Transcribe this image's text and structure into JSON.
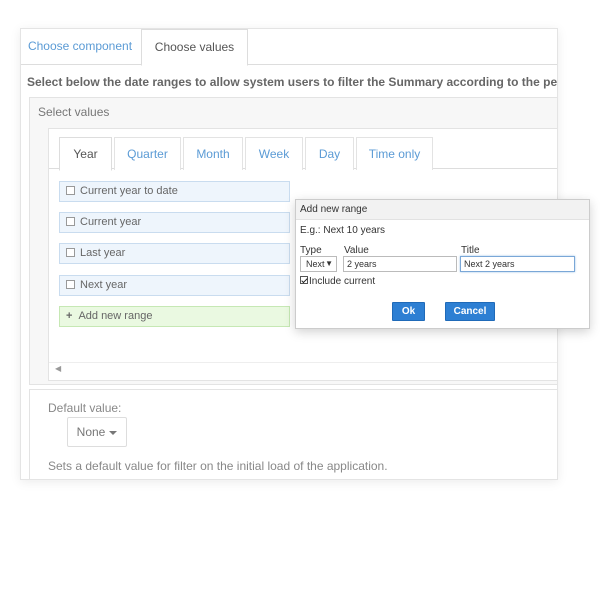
{
  "tabs": {
    "choose_component": "Choose component",
    "choose_values": "Choose values"
  },
  "instruction": "Select below the date ranges to allow system users to filter the Summary according to the periods di",
  "select_values": {
    "label": "Select values",
    "tabs": [
      "Year",
      "Quarter",
      "Month",
      "Week",
      "Day",
      "Time only"
    ],
    "active_tab": "Year",
    "ranges": [
      "Current year to date",
      "Current year",
      "Last year",
      "Next year"
    ],
    "add_range_label": "Add new range"
  },
  "default_value": {
    "label": "Default value:",
    "selected": "None",
    "help": "Sets a default value for filter on the initial load of the application."
  },
  "dialog": {
    "title": "Add new range",
    "example": "E.g.: Next 10 years",
    "type_label": "Type",
    "value_label": "Value",
    "title_label": "Title",
    "type_value": "Next",
    "value_value": "2 years",
    "title_value": "Next 2 years",
    "include_current_label": "Include current",
    "include_current_checked": true,
    "ok_label": "Ok",
    "cancel_label": "Cancel"
  },
  "colors": {
    "link_blue": "#5b9bd5",
    "button_blue": "#2d7fd3",
    "range_bg": "#eef5fc",
    "add_bg": "#eaf9e1"
  }
}
